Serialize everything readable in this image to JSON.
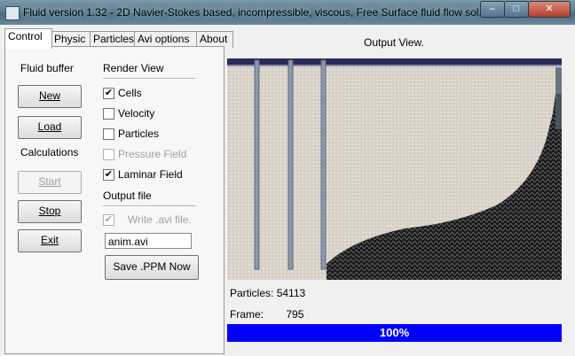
{
  "window": {
    "title": "Fluid version 1.32 - 2D Navier-Stokes based, incompressible, viscous, Free Surface fluid flow sol...",
    "min_glyph": "–",
    "max_glyph": "□",
    "close_glyph": "✕"
  },
  "tabs": [
    "Control",
    "Physic",
    "Particles",
    "Avi options",
    "About"
  ],
  "fluid_buffer": {
    "heading": "Fluid buffer",
    "new_label": "New",
    "load_label": "Load"
  },
  "calculations": {
    "heading": "Calculations",
    "start_label": "Start",
    "stop_label": "Stop",
    "exit_label": "Exit"
  },
  "render_view": {
    "heading": "Render View",
    "options": [
      {
        "label": "Cells",
        "checked": true,
        "enabled": true
      },
      {
        "label": "Velocity",
        "checked": false,
        "enabled": true
      },
      {
        "label": "Particles",
        "checked": false,
        "enabled": true
      },
      {
        "label": "Pressure Field",
        "checked": false,
        "enabled": false
      },
      {
        "label": "Laminar Field",
        "checked": true,
        "enabled": true
      }
    ]
  },
  "output_file": {
    "heading": "Output file",
    "write_avi_label": "Write .avi file.",
    "write_avi_checked": true,
    "filename": "anim.avi",
    "save_ppm_label": "Save .PPM Now"
  },
  "output_view": {
    "title": "Output View.",
    "particles_label": "Particles:",
    "particles_value": "54113",
    "frame_label": "Frame:",
    "frame_value": "795",
    "progress_text": "100%",
    "progress_fraction": 1.0
  }
}
